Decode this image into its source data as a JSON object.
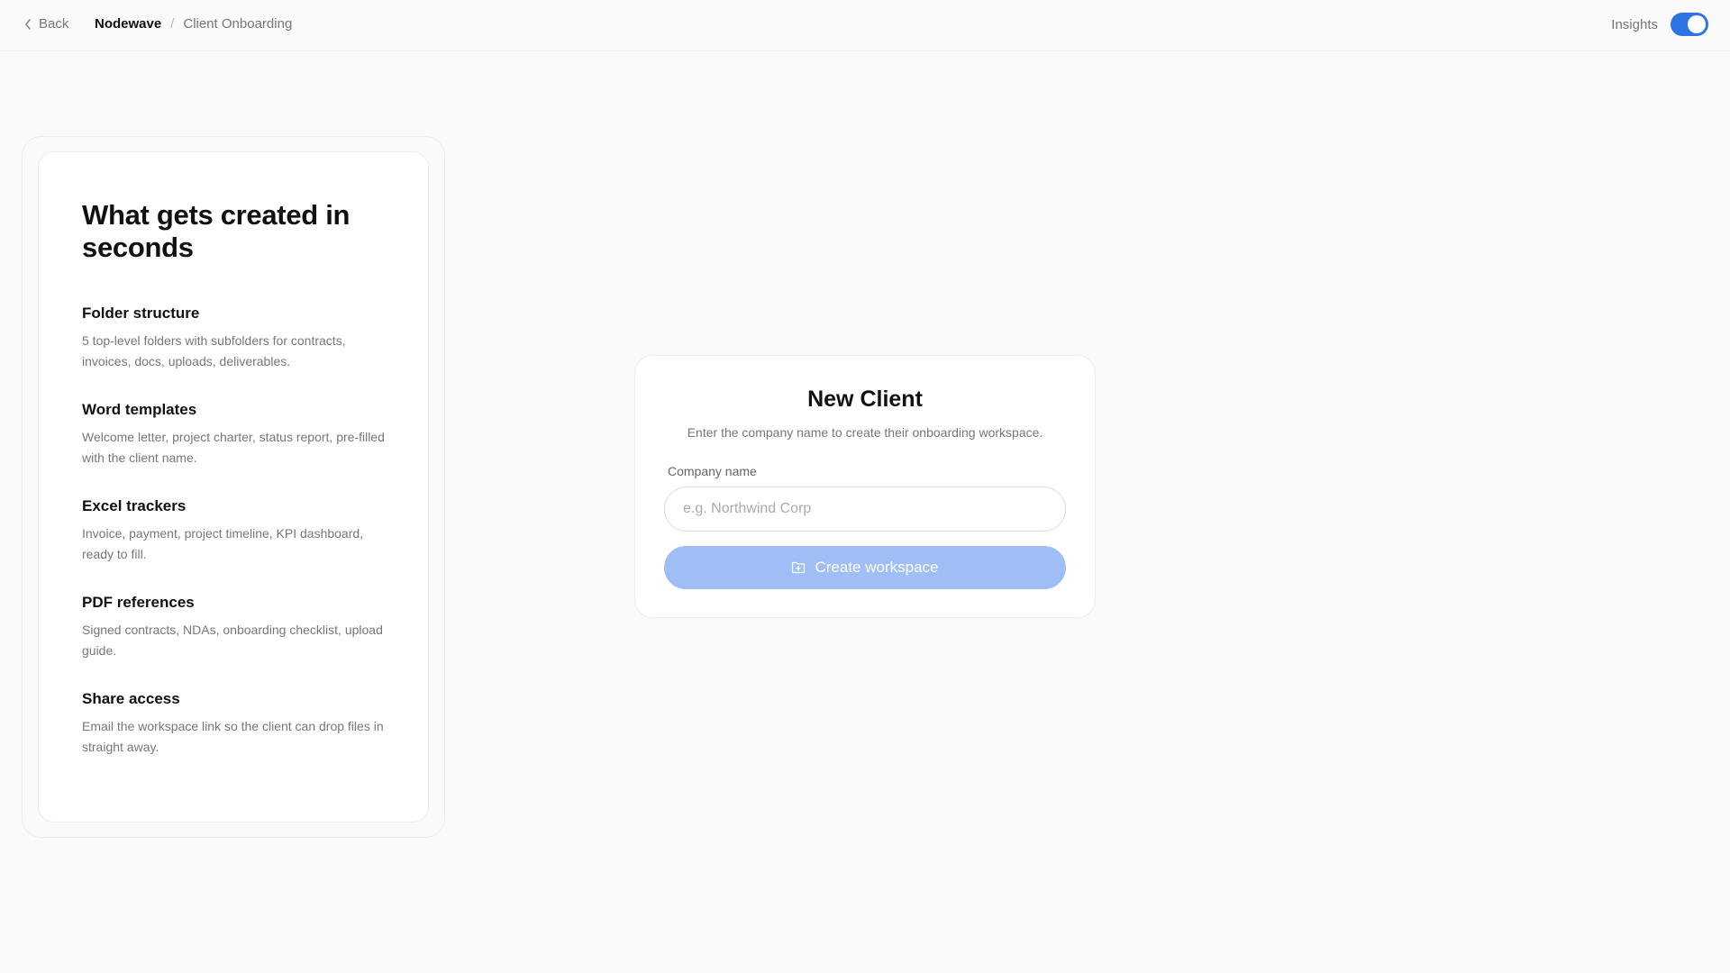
{
  "topbar": {
    "back_label": "Back",
    "breadcrumb_root": "Nodewave",
    "breadcrumb_sep": "/",
    "breadcrumb_current": "Client Onboarding",
    "insights_label": "Insights",
    "insights_enabled": true
  },
  "info_panel": {
    "title": "What gets created in seconds",
    "features": [
      {
        "title": "Folder structure",
        "desc": "5 top-level folders with subfolders for contracts, invoices, docs, uploads, deliverables."
      },
      {
        "title": "Word templates",
        "desc": "Welcome letter, project charter, status report, pre-filled with the client name."
      },
      {
        "title": "Excel trackers",
        "desc": "Invoice, payment, project timeline, KPI dashboard, ready to fill."
      },
      {
        "title": "PDF references",
        "desc": "Signed contracts, NDAs, onboarding checklist, upload guide."
      },
      {
        "title": "Share access",
        "desc": "Email the workspace link so the client can drop files in straight away."
      }
    ]
  },
  "new_client": {
    "title": "New Client",
    "subtitle": "Enter the company name to create their onboarding workspace.",
    "company_label": "Company name",
    "company_placeholder": "e.g. Northwind Corp",
    "company_value": "",
    "create_button": "Create workspace"
  },
  "icons": {
    "back": "chevron-left-icon",
    "create": "folder-plus-icon"
  },
  "colors": {
    "accent": "#2f74e5",
    "button_disabled": "#9ebef5"
  }
}
